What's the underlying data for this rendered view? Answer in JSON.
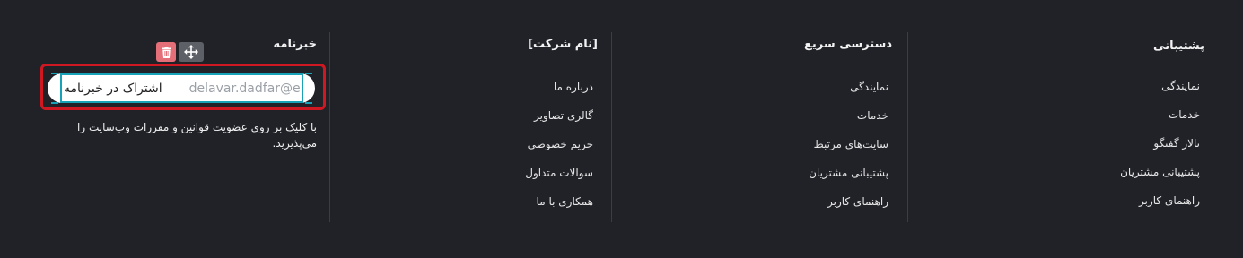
{
  "support": {
    "title": "پشتیبانی",
    "items": [
      "نمایندگی",
      "خدمات",
      "تالار گفتگو",
      "پشتیبانی مشتریان",
      "راهنمای کاربر"
    ]
  },
  "quick_access": {
    "title": "دسترسی سریع",
    "items": [
      "نمایندگی",
      "خدمات",
      "سایت‌های مرتبط",
      "پشتیبانی مشتریان",
      "راهنمای کاربر"
    ]
  },
  "company": {
    "title": "[نام شرکت]",
    "items": [
      "درباره ما",
      "گالری تصاویر",
      "حریم خصوصی",
      "سوالات متداول",
      "همکاری با ما"
    ]
  },
  "newsletter": {
    "title": "خبرنامه",
    "email_value": "delavar.dadfar@e",
    "subscribe_label": "اشتراک در خبرنامه",
    "description": "با کلیک بر روی عضویت قوانین و مقررات وب‌سایت را می‌پذیرید."
  },
  "colors": {
    "background": "#212227",
    "selection": "#d01823",
    "handle": "#17a2b8",
    "delete_tool": "#e46f78"
  },
  "icons": {
    "delete": "trash-icon",
    "move": "move-arrows-icon"
  }
}
